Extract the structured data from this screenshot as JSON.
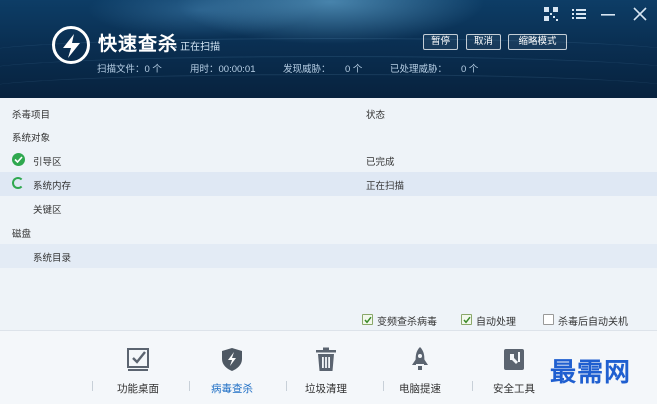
{
  "header": {
    "title": "快速查杀",
    "subtitle": "- 正在扫描",
    "stats": {
      "scanned_files": "扫描文件：0 个",
      "elapsed": "用时：00:00:01",
      "threats_found_label": "发现威胁：",
      "threats_found_value": "0 个",
      "threats_handled_label": "已处理威胁：",
      "threats_handled_value": "0 个"
    },
    "buttons": {
      "pause": "暂停",
      "cancel": "取消",
      "mini_mode": "缩略模式"
    }
  },
  "list": {
    "columns": {
      "item": "杀毒项目",
      "status": "状态"
    },
    "rows": [
      {
        "label": "系统对象",
        "status": "",
        "type": "group"
      },
      {
        "label": "引导区",
        "status": "已完成",
        "type": "done"
      },
      {
        "label": "系统内存",
        "status": "正在扫描",
        "type": "scanning"
      },
      {
        "label": "关键区",
        "status": "",
        "type": "pending"
      },
      {
        "label": "磁盘",
        "status": "",
        "type": "group"
      },
      {
        "label": "系统目录",
        "status": "",
        "type": "pending"
      }
    ]
  },
  "options": {
    "detect_variants": {
      "label": "变频查杀病毒",
      "checked": true
    },
    "auto_handle": {
      "label": "自动处理",
      "checked": true
    },
    "shutdown_after": {
      "label": "杀毒后自动关机",
      "checked": false
    }
  },
  "nav": {
    "items": [
      {
        "label": "功能桌面",
        "icon": "checklist-icon",
        "active": false
      },
      {
        "label": "病毒查杀",
        "icon": "shield-bolt-icon",
        "active": true
      },
      {
        "label": "垃圾清理",
        "icon": "trash-icon",
        "active": false
      },
      {
        "label": "电脑提速",
        "icon": "rocket-icon",
        "active": false
      },
      {
        "label": "安全工具",
        "icon": "toolbox-icon",
        "active": false
      }
    ]
  },
  "watermark": "最需网",
  "colors": {
    "header_bg": "#0a2f52",
    "accent_blue": "#1f6fc5",
    "success_green": "#2fa84f"
  }
}
